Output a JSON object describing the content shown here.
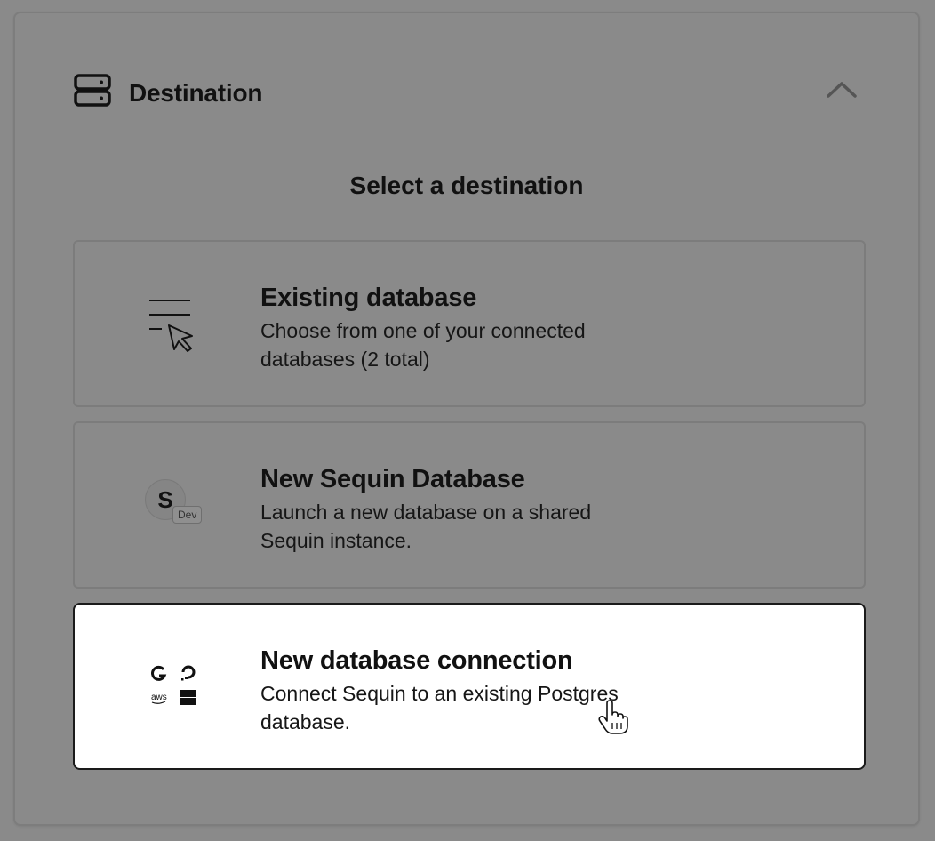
{
  "header": {
    "title": "Destination",
    "icon": "server-icon",
    "toggle_icon": "chevron-up-icon"
  },
  "section": {
    "title": "Select a destination"
  },
  "options": [
    {
      "title": "Existing database",
      "description": "Choose from one of your connected databases (2 total)",
      "icon": "list-select-cursor-icon",
      "selected": false
    },
    {
      "title": "New Sequin Database",
      "description": "Launch a new database on a shared Sequin instance.",
      "icon": "sequin-avatar-icon",
      "avatar_letter": "S",
      "badge": "Dev",
      "selected": false
    },
    {
      "title": "New database connection",
      "description": "Connect Sequin to an existing Postgres database.",
      "icon": "cloud-providers-icon",
      "provider_icons": [
        "google-icon",
        "digitalocean-icon",
        "aws-icon",
        "azure-icon"
      ],
      "aws_text": "aws",
      "selected": true
    }
  ],
  "colors": {
    "overlay_bg": "#8a8a8a",
    "selected_bg": "#ffffff",
    "text": "#111111"
  }
}
